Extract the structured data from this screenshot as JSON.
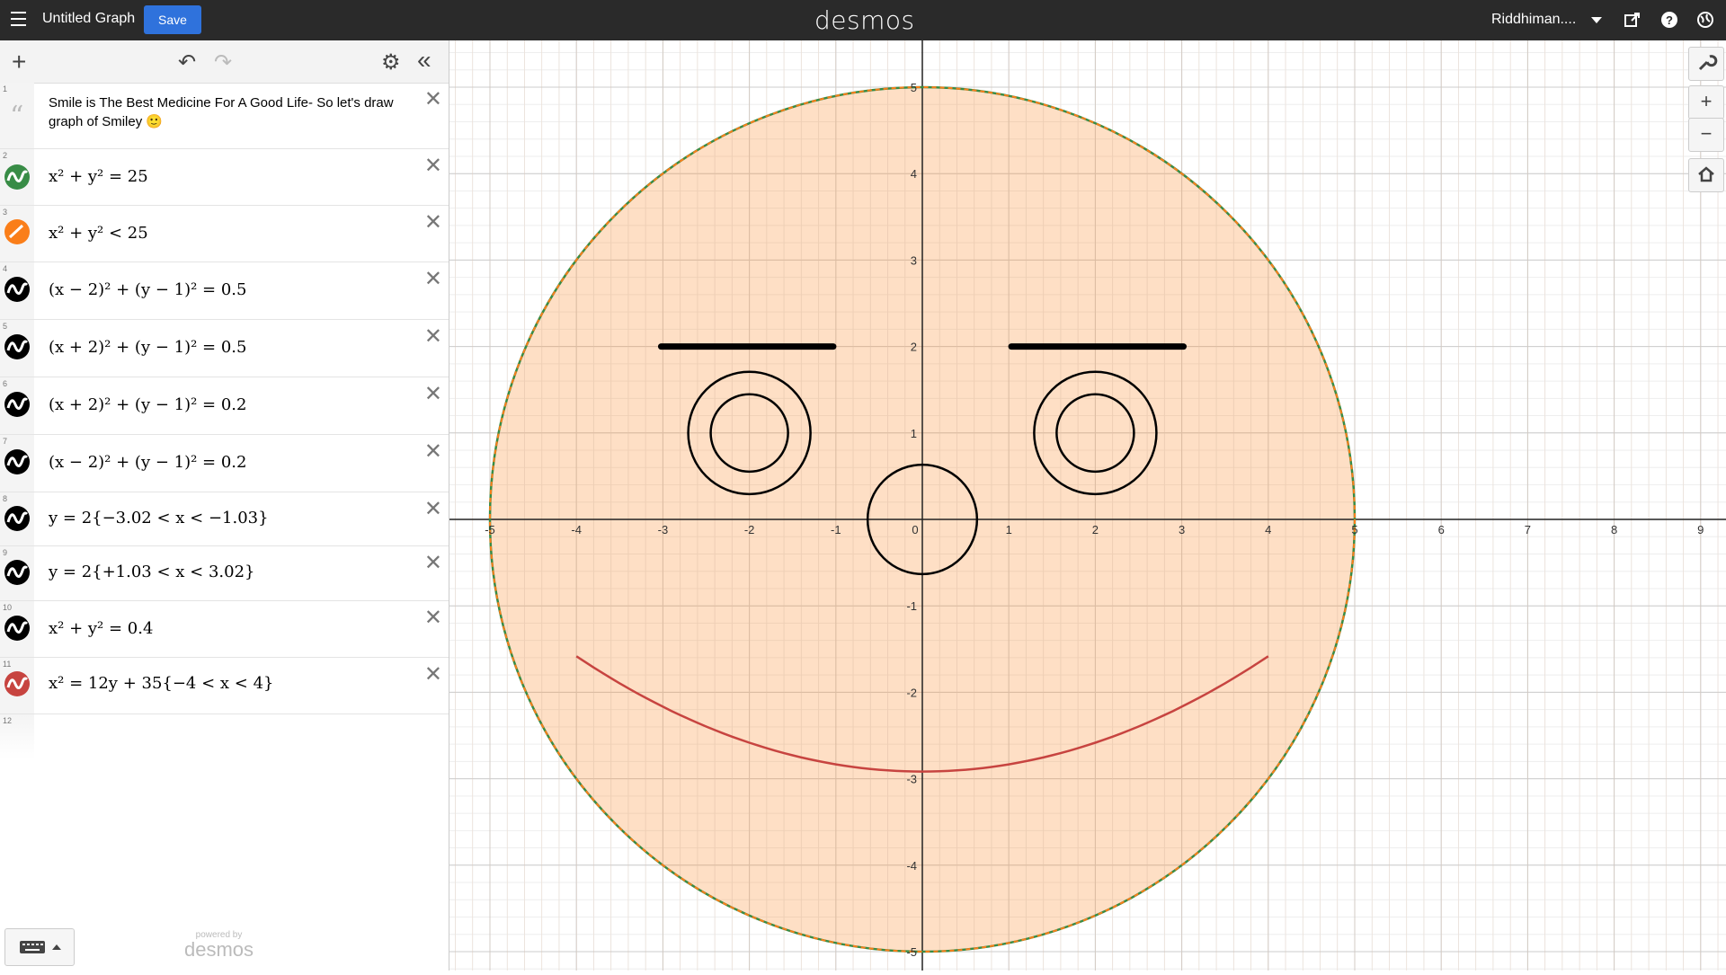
{
  "topbar": {
    "title": "Untitled Graph",
    "save_label": "Save",
    "logo": "desmos",
    "user": "Riddhiman....",
    "icons": [
      "menu-icon",
      "share-icon",
      "help-icon",
      "globe-icon"
    ]
  },
  "panel": {
    "tools": {
      "add": "+",
      "undo": "↶",
      "redo": "↷",
      "settings": "⚙",
      "collapse": "«"
    },
    "rows": [
      {
        "n": "1",
        "type": "note",
        "text": "Smile is The Best Medicine For A Good Life- So let's draw graph of Smiley 🙂"
      },
      {
        "n": "2",
        "color": "#388c46",
        "text": "x² + y² = 25"
      },
      {
        "n": "3",
        "color": "#fa7e19",
        "text": "x² + y² < 25"
      },
      {
        "n": "4",
        "color": "#000000",
        "text": "(x − 2)² + (y − 1)² = 0.5"
      },
      {
        "n": "5",
        "color": "#000000",
        "text": "(x + 2)² + (y − 1)² = 0.5"
      },
      {
        "n": "6",
        "color": "#000000",
        "text": "(x + 2)² + (y − 1)² = 0.2"
      },
      {
        "n": "7",
        "color": "#000000",
        "text": "(x − 2)² + (y − 1)² = 0.2"
      },
      {
        "n": "8",
        "color": "#000000",
        "text": "y = 2{−3.02 < x < −1.03}"
      },
      {
        "n": "9",
        "color": "#000000",
        "text": "y = 2{+1.03 < x < 3.02}"
      },
      {
        "n": "10",
        "color": "#000000",
        "text": "x² + y² = 0.4"
      },
      {
        "n": "11",
        "color": "#c74440",
        "text": "x² = 12y + 35{−4 < x < 4}"
      },
      {
        "n": "12",
        "type": "empty",
        "text": ""
      }
    ],
    "powered_small": "powered by",
    "powered_big": "desmos"
  },
  "graph": {
    "x_ticks": [
      "-5",
      "-4",
      "-3",
      "-2",
      "-1",
      "0",
      "1",
      "2",
      "3",
      "4",
      "5",
      "6",
      "7",
      "8",
      "9"
    ],
    "y_ticks": [
      "5",
      "4",
      "3",
      "2",
      "1",
      "-1",
      "-2",
      "-3",
      "-4",
      "-5"
    ],
    "zoom": {
      "wrench": "🔧",
      "plus": "+",
      "minus": "−",
      "home": "⌂"
    }
  }
}
